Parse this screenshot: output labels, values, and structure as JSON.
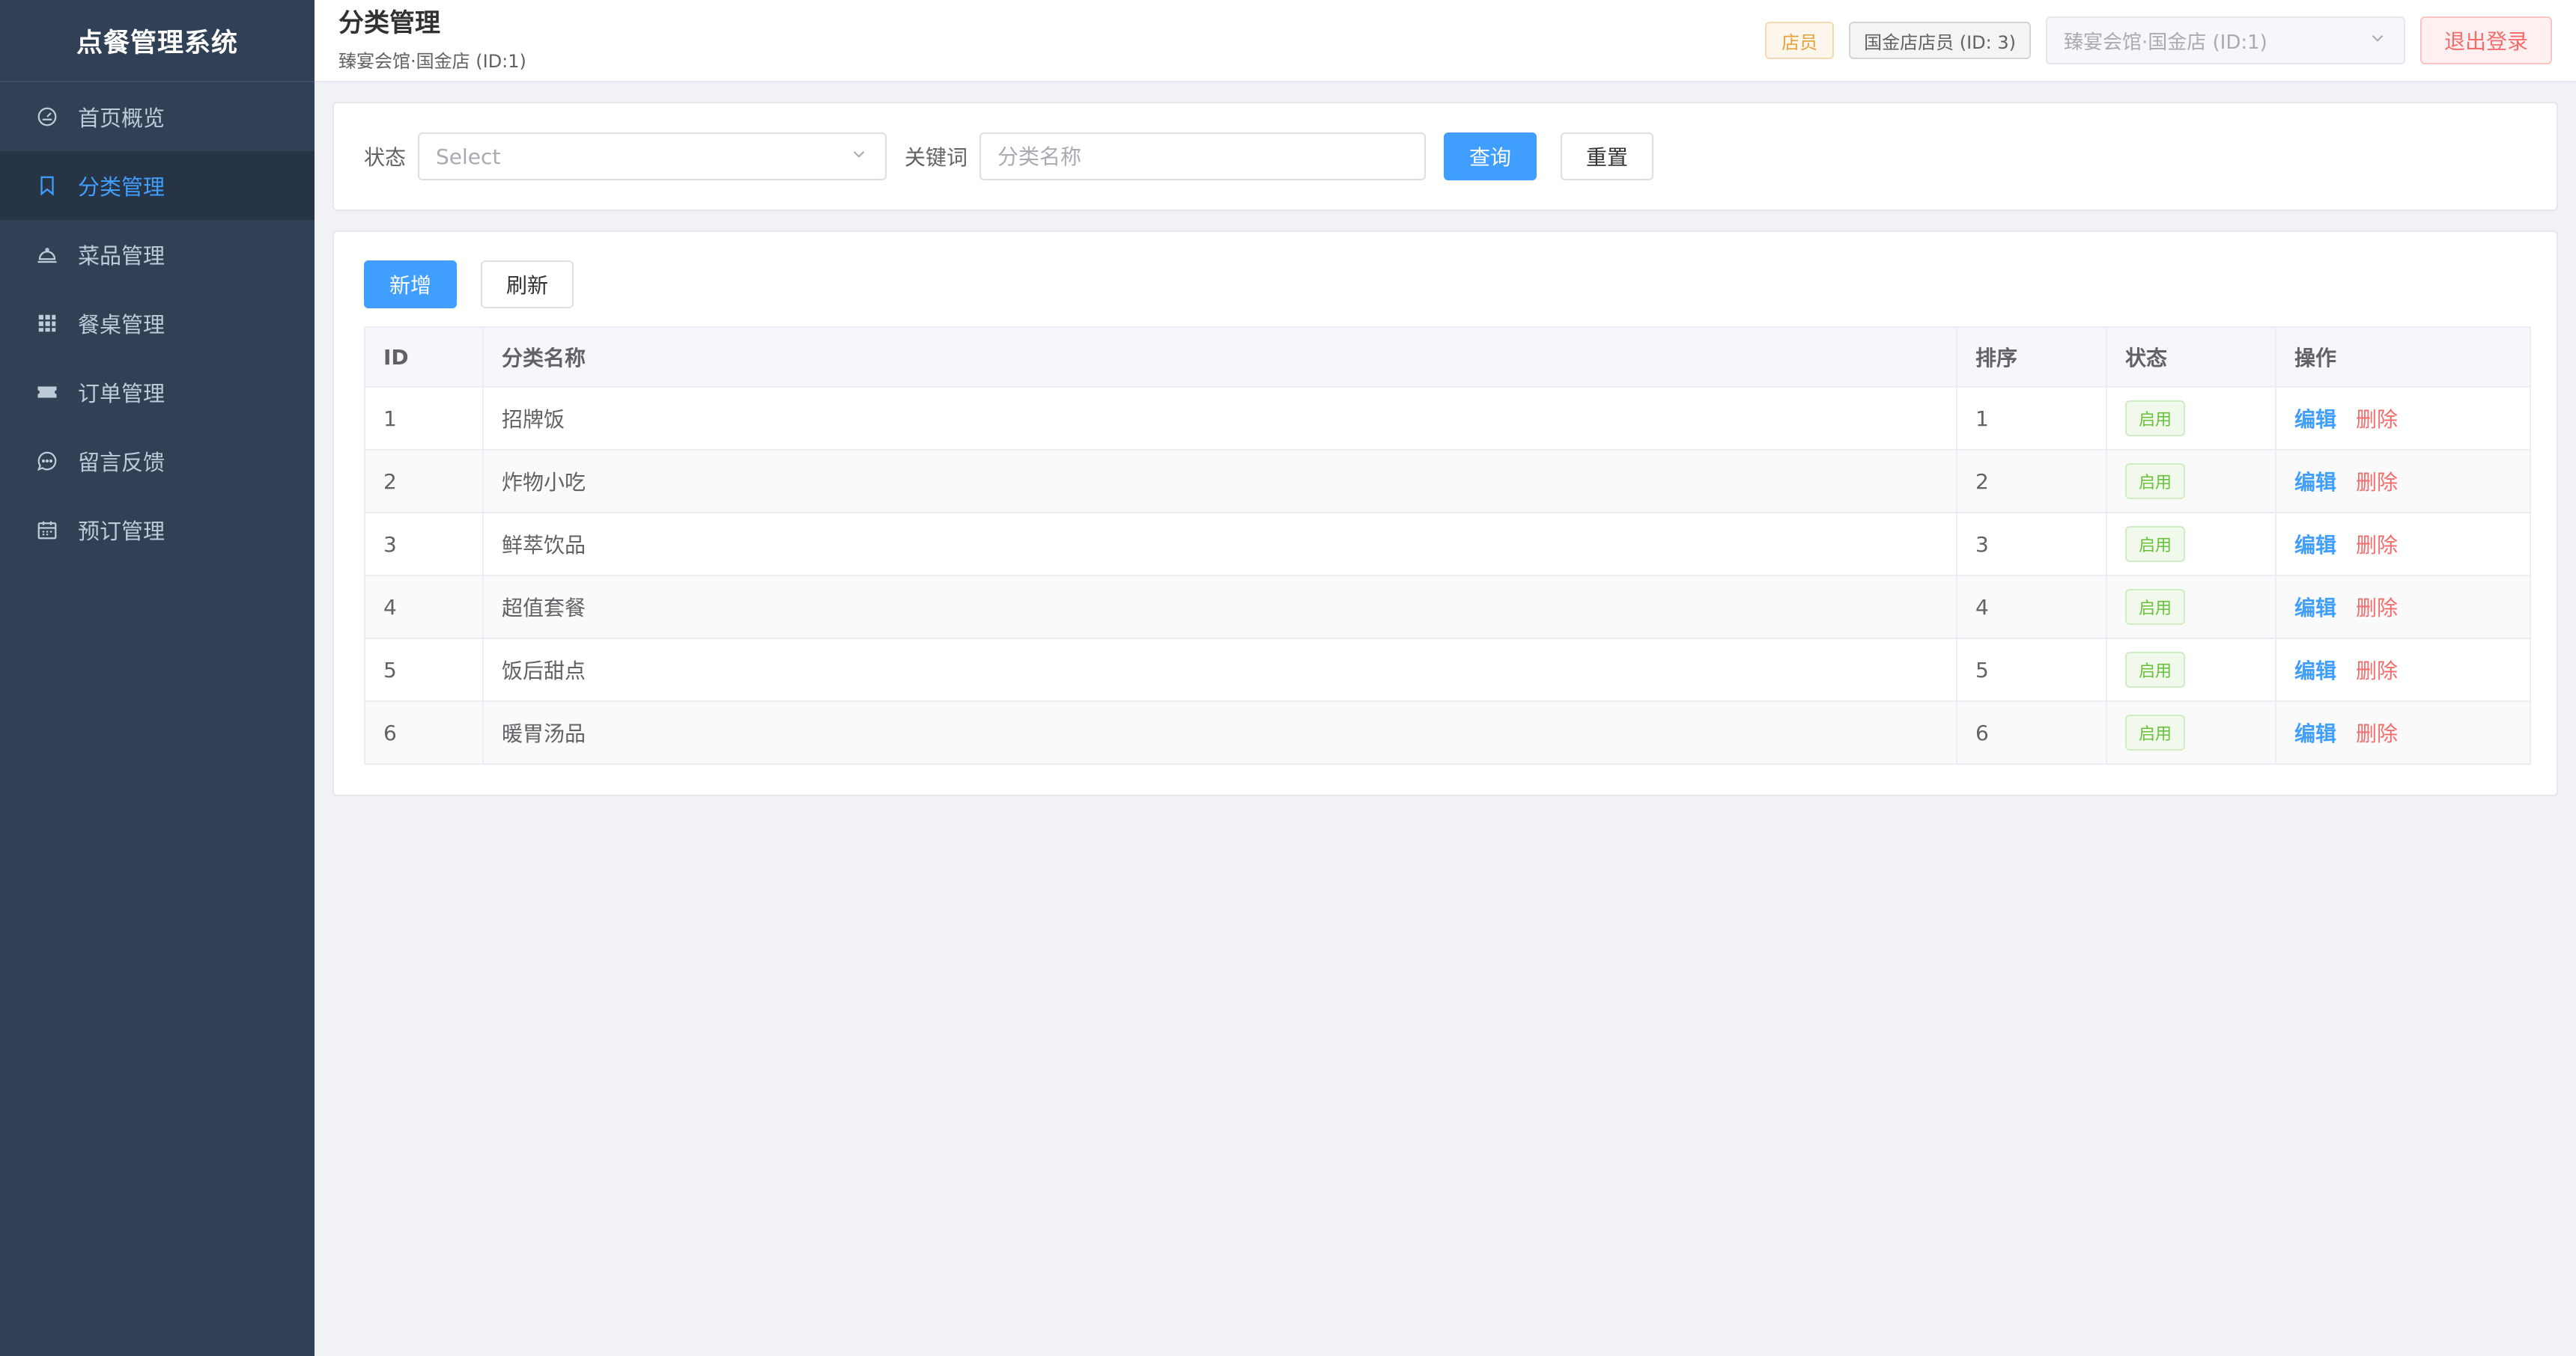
{
  "app": {
    "title": "点餐管理系统"
  },
  "sidebar": {
    "items": [
      {
        "label": "首页概览",
        "icon": "dashboard-icon",
        "active": false
      },
      {
        "label": "分类管理",
        "icon": "bookmark-icon",
        "active": true
      },
      {
        "label": "菜品管理",
        "icon": "dish-icon",
        "active": false
      },
      {
        "label": "餐桌管理",
        "icon": "grid-icon",
        "active": false
      },
      {
        "label": "订单管理",
        "icon": "ticket-icon",
        "active": false
      },
      {
        "label": "留言反馈",
        "icon": "chat-icon",
        "active": false
      },
      {
        "label": "预订管理",
        "icon": "calendar-icon",
        "active": false
      }
    ]
  },
  "header": {
    "title": "分类管理",
    "subtitle": "臻宴会馆·国金店 (ID:1)",
    "role": "店员",
    "user": "国金店店员 (ID: 3)",
    "store_select": "臻宴会馆·国金店 (ID:1)",
    "logout": "退出登录"
  },
  "filter": {
    "status_label": "状态",
    "status_placeholder": "Select",
    "keyword_label": "关键词",
    "keyword_placeholder": "分类名称",
    "query_button": "查询",
    "reset_button": "重置"
  },
  "toolbar": {
    "add_button": "新增",
    "refresh_button": "刷新"
  },
  "table": {
    "columns": [
      "ID",
      "分类名称",
      "排序",
      "状态",
      "操作"
    ],
    "rows": [
      {
        "id": "1",
        "name": "招牌饭",
        "sort": "1",
        "status": "启用",
        "edit": "编辑",
        "delete": "删除"
      },
      {
        "id": "2",
        "name": "炸物小吃",
        "sort": "2",
        "status": "启用",
        "edit": "编辑",
        "delete": "删除"
      },
      {
        "id": "3",
        "name": "鲜萃饮品",
        "sort": "3",
        "status": "启用",
        "edit": "编辑",
        "delete": "删除"
      },
      {
        "id": "4",
        "name": "超值套餐",
        "sort": "4",
        "status": "启用",
        "edit": "编辑",
        "delete": "删除"
      },
      {
        "id": "5",
        "name": "饭后甜点",
        "sort": "5",
        "status": "启用",
        "edit": "编辑",
        "delete": "删除"
      },
      {
        "id": "6",
        "name": "暖胃汤品",
        "sort": "6",
        "status": "启用",
        "edit": "编辑",
        "delete": "删除"
      }
    ]
  },
  "colors": {
    "sidebar_bg": "#304156",
    "sidebar_active_bg": "#263445",
    "accent": "#409eff",
    "danger": "#f56c6c",
    "success": "#67c23a",
    "warning": "#e6a23c"
  }
}
